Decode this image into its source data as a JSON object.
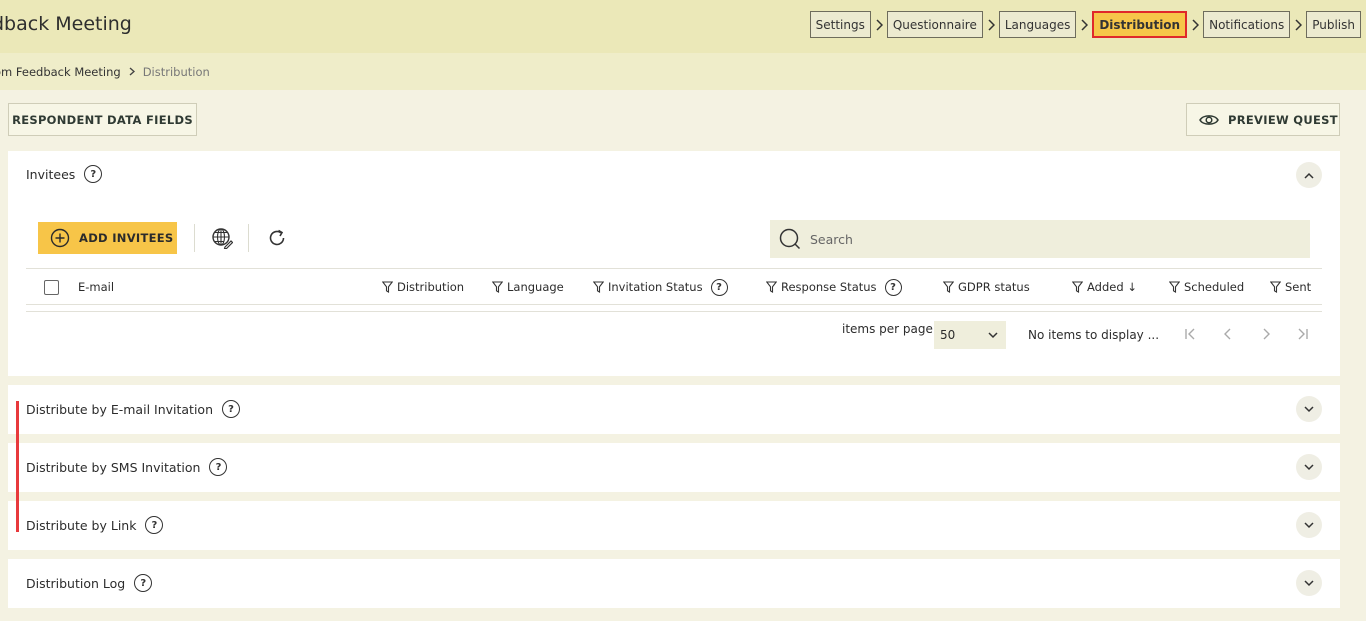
{
  "header": {
    "title": "dback Meeting"
  },
  "steps": [
    {
      "label": "Settings",
      "active": false
    },
    {
      "label": "Questionnaire",
      "active": false
    },
    {
      "label": "Languages",
      "active": false
    },
    {
      "label": "Distribution",
      "active": true
    },
    {
      "label": "Notifications",
      "active": false
    },
    {
      "label": "Publish",
      "active": false
    }
  ],
  "breadcrumb": {
    "parent": "om Feedback Meeting",
    "current": "Distribution"
  },
  "buttons": {
    "respondent_data_fields": "RESPONDENT DATA FIELDS",
    "preview": "PREVIEW QUEST"
  },
  "invitees": {
    "title": "Invitees",
    "add_label": "ADD INVITEES",
    "search_placeholder": "Search",
    "columns": {
      "email": "E-mail",
      "distribution": "Distribution",
      "language": "Language",
      "invitation_status": "Invitation Status",
      "response_status": "Response Status",
      "gdpr": "GDPR status",
      "added": "Added ↓",
      "scheduled": "Scheduled",
      "sent": "Sent"
    },
    "pager": {
      "items_per_page_label": "items per page",
      "items_per_page_value": "50",
      "no_items": "No items to display ..."
    }
  },
  "sections": {
    "email": "Distribute by E-mail Invitation",
    "sms": "Distribute by SMS Invitation",
    "link": "Distribute by Link",
    "log": "Distribution Log"
  },
  "help_glyph": "?",
  "colors": {
    "accent": "#f7c548",
    "active_border": "#e0282b",
    "header_bg": "#ebe8b8",
    "highlight_line": "#e8393c"
  }
}
